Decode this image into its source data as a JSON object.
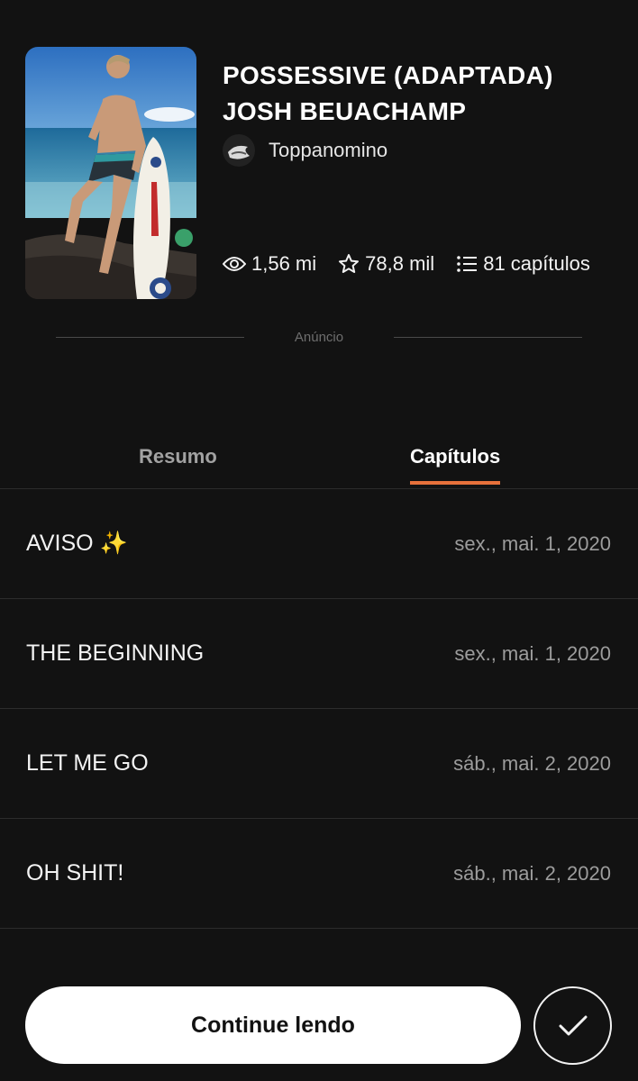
{
  "story": {
    "title_line1": "POSSESSIVE (ADAPTADA)",
    "title_line2": "JOSH BEUACHAMP",
    "author": "Toppanomino",
    "cover_alt": "Capa da história",
    "stats": {
      "reads": "1,56 mi",
      "votes": "78,8 mil",
      "parts": "81 capítulos"
    }
  },
  "ad": {
    "label": "Anúncio"
  },
  "tabs": [
    {
      "label": "Resumo",
      "active": false
    },
    {
      "label": "Capítulos",
      "active": true
    }
  ],
  "chapters": [
    {
      "title": "AVISO ✨",
      "date": "sex., mai. 1, 2020"
    },
    {
      "title": "THE BEGINNING",
      "date": "sex., mai. 1, 2020"
    },
    {
      "title": "LET ME GO",
      "date": "sáb., mai. 2, 2020"
    },
    {
      "title": "OH SHIT!",
      "date": "sáb., mai. 2, 2020"
    }
  ],
  "actions": {
    "continue_label": "Continue lendo",
    "check_icon": "checkmark-icon"
  },
  "colors": {
    "background": "#121212",
    "accent": "#e7713b",
    "divider": "#2c2c2c"
  },
  "icons": {
    "reads": "eye-icon",
    "votes": "star-icon",
    "parts": "list-icon"
  }
}
